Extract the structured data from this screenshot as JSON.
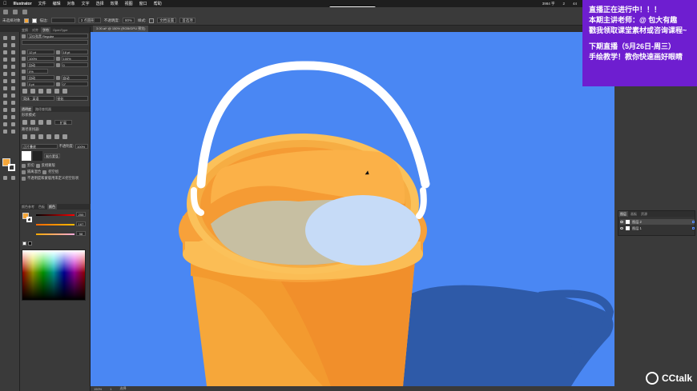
{
  "menubar": {
    "app_name": "Illustrator",
    "menus": [
      "文件",
      "编辑",
      "对象",
      "文字",
      "选择",
      "效果",
      "视图",
      "窗口",
      "帮助"
    ],
    "status_items": [
      "3984 字",
      "2",
      "44"
    ]
  },
  "recording": {
    "label": "• 录制中01:02:57"
  },
  "control_bar": {
    "selection": "未选择对象",
    "stroke_label": "描边:",
    "brush": "3 点圆形",
    "opacity_label": "不透明度:",
    "opacity": "80%",
    "style_label": "样式:",
    "doc_settings": "文档设置",
    "preferences": "首选项"
  },
  "document": {
    "tab": "3.00.ai* @ 150% (RGB/GPU 预览)"
  },
  "left_panel": {
    "tabs": [
      "变换",
      "对齐",
      "字符",
      "OpenType"
    ],
    "font_family": "汉仪劲黑 Regular",
    "font_size": "12 pt",
    "leading": "18 pt",
    "scale_h": "100%",
    "scale_v": "100%",
    "tracking_auto": "自动",
    "tracking": "0",
    "kern": "0%",
    "auto1": "自动",
    "auto2": "自动",
    "baseline": "0 pt",
    "rotation": "0°",
    "lang": "简体 · 英语",
    "aa": "锐化",
    "transparency_tabs": [
      "透明度",
      "路径查找器"
    ],
    "blend_mode_label": "混合模式",
    "shape_modes": "形状模式:",
    "pathfinder_label": "路径查找器:",
    "expand_btn": "扩展",
    "normal": "正片叠底",
    "opacity_label": "不透明度:",
    "opacity": "100%",
    "make_mask": "制作蒙版",
    "clip": "剪切",
    "invert": "反相蒙版",
    "isolate": "隔离混合",
    "knockout": "挖空组",
    "opacity_mask_def": "不透明度和蒙版用来定义挖空形状",
    "color_tabs": [
      "颜色参考",
      "色板",
      "颜色"
    ],
    "r": "255",
    "g": "167",
    "b": "58"
  },
  "layers_panel": {
    "tabs": [
      "图层",
      "画板",
      "资源"
    ],
    "rows": [
      "图层 2",
      "图层 1"
    ]
  },
  "statusbar": {
    "zoom": "150%",
    "page": "1",
    "tool": "选择"
  },
  "promo": {
    "line1": "直播正在进行中！！！",
    "line2": "本期主讲老师：@ 包大有趣",
    "line3": "戳我领取课堂素材或咨询课程~",
    "line4": "下期直播（5月26日-周三）",
    "line5": "手绘教学！教你快速画好眼睛"
  },
  "watermark": {
    "brand": "CCtalk"
  },
  "colors": {
    "canvas_bg": "#4a87f3",
    "bucket_orange": "#f6a73a",
    "bucket_dark": "#f08a2a",
    "rim": "#fbc15a",
    "handle": "#ffffff",
    "shadow": "#2e5aa8",
    "water": "#c6dbf7",
    "promo_bg": "#6e1ed0"
  }
}
